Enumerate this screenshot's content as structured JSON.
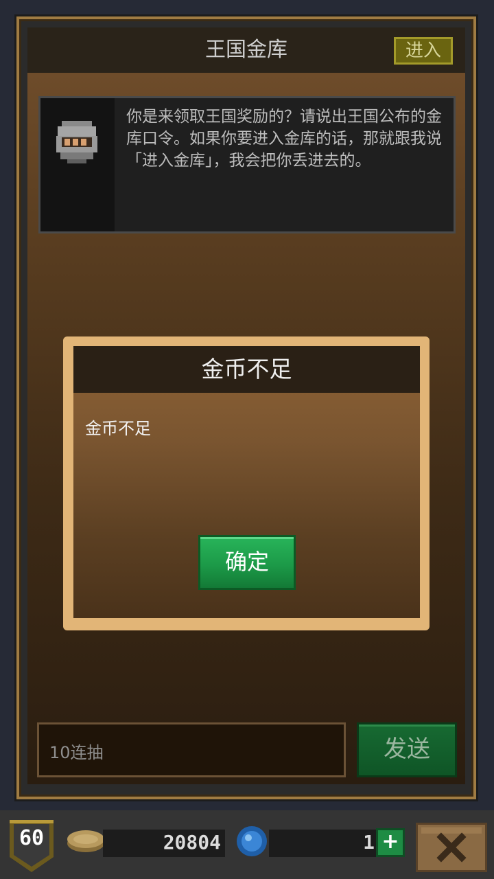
{
  "header": {
    "title": "王国金库",
    "enter_button": "进入"
  },
  "npc": {
    "avatar_icon": "knight-helmet-icon",
    "message": "你是来领取王国奖励的？请说出王国公布的金库口令。如果你要进入金库的话，那就跟我说「进入金库」，我会把你丢进去的。"
  },
  "dialog": {
    "title": "金币不足",
    "message": "金币不足",
    "confirm_button": "确定"
  },
  "input": {
    "value": "10连抽",
    "send_button": "发送"
  },
  "status_bar": {
    "level": "60",
    "coins": "20804",
    "gems": "1",
    "plus_icon": "plus-icon",
    "close_icon": "close-icon"
  },
  "colors": {
    "frame_border": "#a07c43",
    "dialog_border": "#e2b577",
    "confirm_green": "#1c9a48",
    "send_green": "#176a32"
  }
}
